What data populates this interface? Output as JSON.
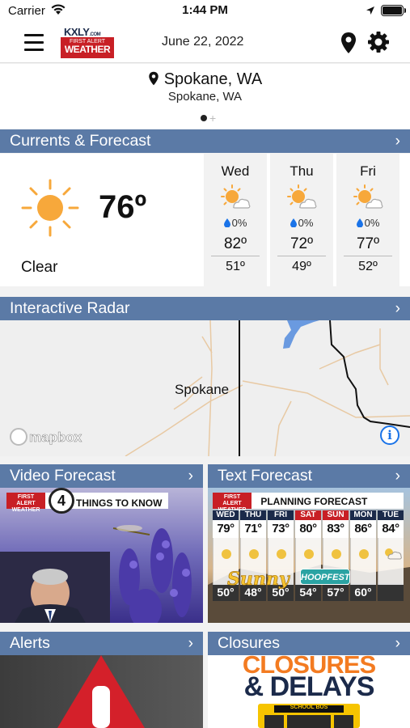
{
  "status_bar": {
    "carrier": "Carrier",
    "time": "1:44 PM"
  },
  "header": {
    "logo": {
      "brand": "KXLY",
      "domain": ".COM",
      "line1": "FIRST ALERT",
      "line2": "WEATHER"
    },
    "date": "June 22, 2022",
    "icons": [
      "menu-icon",
      "location-pin-icon",
      "gear-icon"
    ]
  },
  "location": {
    "name": "Spokane, WA",
    "subname": "Spokane, WA",
    "page_count": 1
  },
  "currents": {
    "section_title": "Currents & Forecast",
    "temp": "76º",
    "condition": "Clear",
    "icon": "sun-icon",
    "days": [
      {
        "name": "Wed",
        "precip": "0%",
        "high": "82º",
        "low": "51º",
        "icon": "partly-cloudy-icon"
      },
      {
        "name": "Thu",
        "precip": "0%",
        "high": "72º",
        "low": "49º",
        "icon": "partly-cloudy-icon"
      },
      {
        "name": "Fri",
        "precip": "0%",
        "high": "77º",
        "low": "52º",
        "icon": "partly-cloudy-icon"
      }
    ]
  },
  "radar": {
    "section_title": "Interactive Radar",
    "city_label": "Spokane",
    "attribution": "mapbox"
  },
  "video": {
    "section_title": "Video Forecast",
    "badge_line1": "FIRST ALERT",
    "badge_line2": "WEATHER",
    "channel": "4",
    "ribbon": "THINGS TO KNOW"
  },
  "text_forecast": {
    "section_title": "Text Forecast",
    "badge_line1": "FIRST ALERT",
    "badge_line2": "WEATHER",
    "ribbon": "PLANNING FORECAST",
    "days": [
      {
        "d": "WED",
        "hi": "79°",
        "lo": "50°",
        "weekend": false
      },
      {
        "d": "THU",
        "hi": "71°",
        "lo": "48°",
        "weekend": false
      },
      {
        "d": "FRI",
        "hi": "73°",
        "lo": "50°",
        "weekend": false
      },
      {
        "d": "SAT",
        "hi": "80°",
        "lo": "54°",
        "weekend": true
      },
      {
        "d": "SUN",
        "hi": "83°",
        "lo": "57°",
        "weekend": true
      },
      {
        "d": "MON",
        "hi": "86°",
        "lo": "60°",
        "weekend": false
      },
      {
        "d": "TUE",
        "hi": "84°",
        "lo": "",
        "weekend": false
      }
    ],
    "overlay_text": "Sunny",
    "event_badge": "HOOPFEST"
  },
  "alerts": {
    "section_title": "Alerts"
  },
  "closures": {
    "section_title": "Closures",
    "headline1": "CLOSURES",
    "headline2": "& DELAYS",
    "bus_label": "SCHOOL BUS"
  },
  "colors": {
    "section_header": "#5b7aa6",
    "brand_red": "#c81f25",
    "brand_navy": "#1b2a4a",
    "sun": "#f7a83b"
  }
}
